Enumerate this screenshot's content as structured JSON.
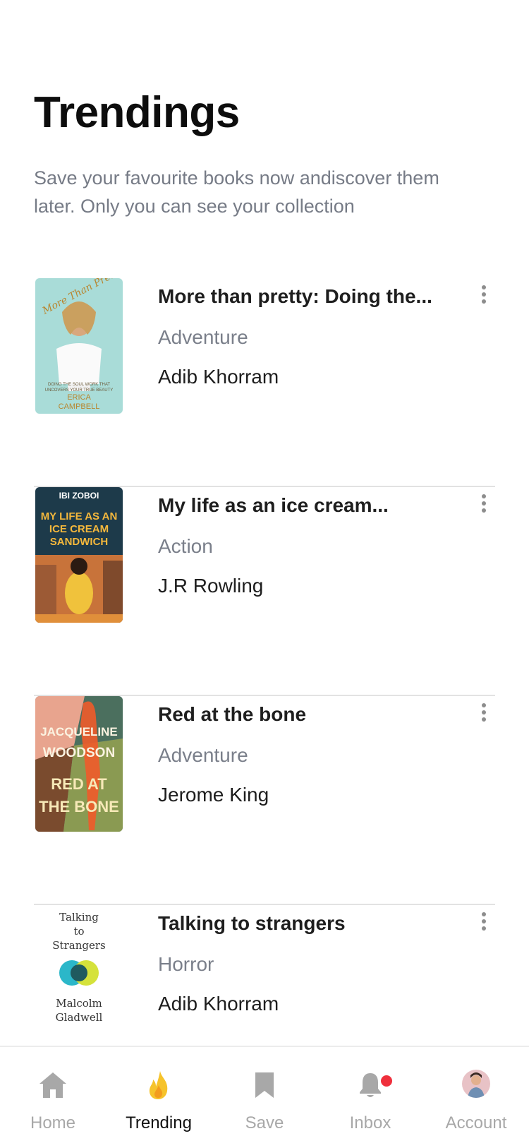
{
  "page": {
    "title": "Trendings",
    "subtitle": "Save your favourite books now andiscover them later. Only you can see your collection"
  },
  "books": [
    {
      "title": "More than pretty: Doing the...",
      "genre": "Adventure",
      "author": "Adib Khorram",
      "cover": {
        "script": "More Than Pretty",
        "tagline_1": "DOING THE SOUL WORK THAT",
        "tagline_2": "UNCOVERS YOUR TRUE BEAUTY",
        "author_1": "ERICA",
        "author_2": "CAMPBELL"
      }
    },
    {
      "title": "My life as an ice cream...",
      "genre": "Action",
      "author": "J.R Rowling",
      "cover": {
        "author": "IBI ZOBOI",
        "line_1": "MY LIFE AS AN",
        "line_2": "ICE CREAM",
        "line_3": "SANDWICH"
      }
    },
    {
      "title": "Red at the bone",
      "genre": "Adventure",
      "author": "Jerome King",
      "cover": {
        "author_1": "JACQUELINE",
        "author_2": "WOODSON",
        "line_1": "RED AT",
        "line_2": "THE BONE"
      }
    },
    {
      "title": "Talking to strangers",
      "genre": "Horror",
      "author": "Adib Khorram",
      "cover": {
        "line_1": "Talking",
        "line_2": "to",
        "line_3": "Strangers",
        "author_1": "Malcolm",
        "author_2": "Gladwell"
      }
    }
  ],
  "tabs": [
    {
      "label": "Home",
      "icon": "home-icon",
      "active": false
    },
    {
      "label": "Trending",
      "icon": "flame-icon",
      "active": true
    },
    {
      "label": "Save",
      "icon": "bookmark-icon",
      "active": false
    },
    {
      "label": "Inbox",
      "icon": "bell-icon",
      "active": false,
      "badge": true
    },
    {
      "label": "Account",
      "icon": "avatar",
      "active": false
    }
  ],
  "colors": {
    "accent_flame": "#f6c32b",
    "badge": "#ef2f3c",
    "inactive": "#a8a8a8",
    "subtitle": "#767b86"
  }
}
